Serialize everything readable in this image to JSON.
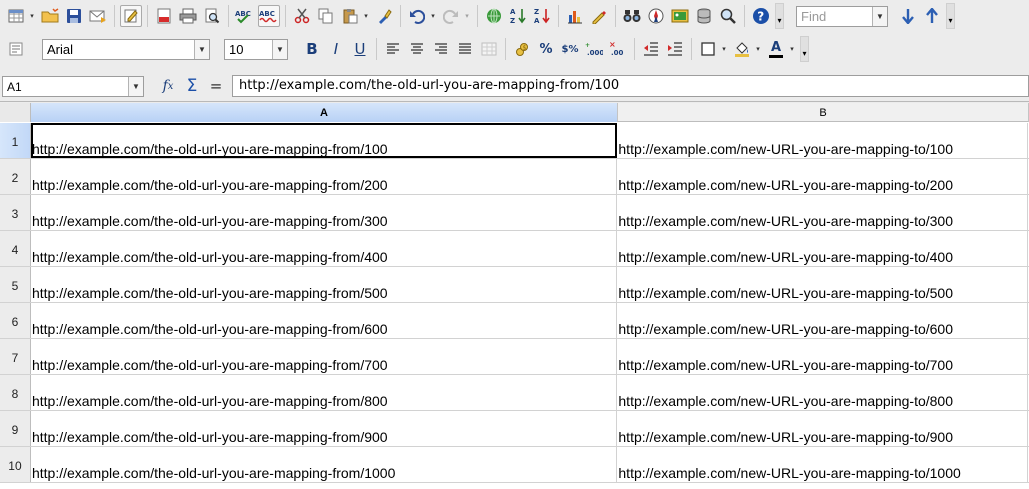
{
  "standard_toolbar": {
    "find_placeholder": "Find"
  },
  "format_toolbar": {
    "font_name": "Arial",
    "font_size": "10",
    "bold_label": "B",
    "italic_label": "I",
    "underline_label": "U",
    "percent_label": "%",
    "currency_label": "$%",
    "font_color_label": "A"
  },
  "formula_bar": {
    "cell_ref": "A1",
    "sum_label": "Σ",
    "equals_label": "=",
    "content": "http://example.com/the-old-url-you-are-mapping-from/100"
  },
  "grid": {
    "columns": [
      "A",
      "B"
    ],
    "rows": [
      {
        "num": "1",
        "a": "http://example.com/the-old-url-you-are-mapping-from/100",
        "b": "http://example.com/new-URL-you-are-mapping-to/100"
      },
      {
        "num": "2",
        "a": "http://example.com/the-old-url-you-are-mapping-from/200",
        "b": "http://example.com/new-URL-you-are-mapping-to/200"
      },
      {
        "num": "3",
        "a": "http://example.com/the-old-url-you-are-mapping-from/300",
        "b": "http://example.com/new-URL-you-are-mapping-to/300"
      },
      {
        "num": "4",
        "a": "http://example.com/the-old-url-you-are-mapping-from/400",
        "b": "http://example.com/new-URL-you-are-mapping-to/400"
      },
      {
        "num": "5",
        "a": "http://example.com/the-old-url-you-are-mapping-from/500",
        "b": "http://example.com/new-URL-you-are-mapping-to/500"
      },
      {
        "num": "6",
        "a": "http://example.com/the-old-url-you-are-mapping-from/600",
        "b": "http://example.com/new-URL-you-are-mapping-to/600"
      },
      {
        "num": "7",
        "a": "http://example.com/the-old-url-you-are-mapping-from/700",
        "b": "http://example.com/new-URL-you-are-mapping-to/700"
      },
      {
        "num": "8",
        "a": "http://example.com/the-old-url-you-are-mapping-from/800",
        "b": "http://example.com/new-URL-you-are-mapping-to/800"
      },
      {
        "num": "9",
        "a": "http://example.com/the-old-url-you-are-mapping-from/900",
        "b": "http://example.com/new-URL-you-are-mapping-to/900"
      },
      {
        "num": "10",
        "a": "http://example.com/the-old-url-you-are-mapping-from/1000",
        "b": "http://example.com/new-URL-you-are-mapping-to/1000"
      }
    ]
  },
  "colors": {
    "selection": "#b8d1f5",
    "accent_blue": "#1b3e7a",
    "toolbar_bg": "#ececec"
  }
}
